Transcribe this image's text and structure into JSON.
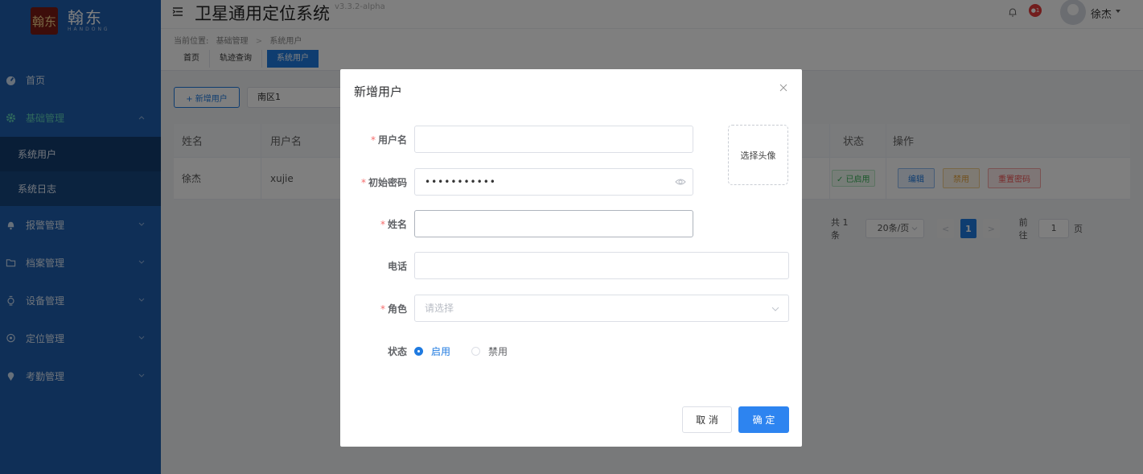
{
  "sidebar": {
    "logo_mark": "翰东",
    "logo_cn": "翰东",
    "logo_en": "HANDONG",
    "menu": [
      {
        "label": "首页",
        "icon": "dashboard-icon"
      },
      {
        "label": "基础管理",
        "icon": "gear-icon",
        "expanded": true
      },
      {
        "label": "报警管理",
        "icon": "bell-icon"
      },
      {
        "label": "档案管理",
        "icon": "folder-icon"
      },
      {
        "label": "设备管理",
        "icon": "watch-icon"
      },
      {
        "label": "定位管理",
        "icon": "location-icon"
      },
      {
        "label": "考勤管理",
        "icon": "pin-icon"
      }
    ],
    "submenu": [
      {
        "label": "系统用户"
      },
      {
        "label": "系统日志"
      }
    ]
  },
  "header": {
    "title": "卫星通用定位系统",
    "version": "v3.3.2-alpha",
    "badge": "●1",
    "user": "徐杰"
  },
  "breadcrumb": {
    "prefix": "当前位置:",
    "items": [
      "基础管理",
      "系统用户"
    ],
    "separator": ">"
  },
  "tabs": [
    "首页",
    "轨迹查询",
    "系统用户"
  ],
  "toolbar": {
    "new_user": "+ 新增用户",
    "filter_value": "南区1"
  },
  "table": {
    "columns": {
      "name": "姓名",
      "username": "用户名",
      "status": "状态",
      "actions": "操作"
    },
    "rows": [
      {
        "name": "徐杰",
        "username": "xujie",
        "status": "✓ 已启用",
        "edit": "编辑",
        "disable": "禁用",
        "reset": "重置密码"
      }
    ]
  },
  "pagination": {
    "total": "共 1 条",
    "page_size": "20条/页",
    "prev": "<",
    "current": "1",
    "next": ">",
    "goto_prefix": "前往",
    "goto_value": "1",
    "goto_suffix": "页"
  },
  "dialog": {
    "title": "新增用户",
    "fields": {
      "username": {
        "label": "用户名",
        "required": "*",
        "value": ""
      },
      "password": {
        "label": "初始密码",
        "required": "*",
        "value": "•••••••••••"
      },
      "realname": {
        "label": "姓名",
        "required": "*",
        "value": ""
      },
      "phone": {
        "label": "电话",
        "value": ""
      },
      "role": {
        "label": "角色",
        "required": "*",
        "placeholder": "请选择"
      },
      "status": {
        "label": "状态",
        "options": [
          "启用",
          "禁用"
        ],
        "selected": "启用"
      }
    },
    "avatar_label": "选择头像",
    "cancel": "取 消",
    "confirm": "确 定"
  },
  "colors": {
    "sidebar": "#1f5fae",
    "primary": "#1f7ae0",
    "success": "#3bb15a",
    "warning": "#e5a23c",
    "danger": "#f05656"
  }
}
